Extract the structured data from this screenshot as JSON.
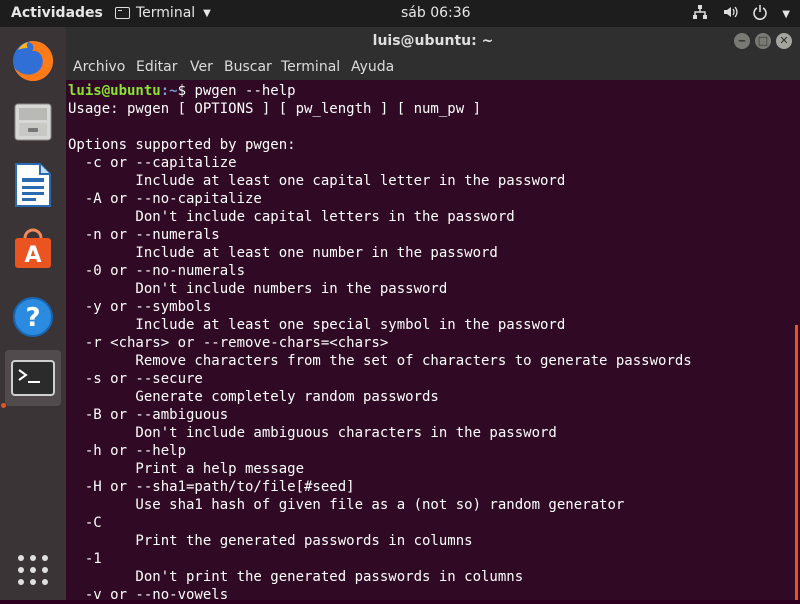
{
  "topbar": {
    "activities": "Actividades",
    "app_name": "Terminal",
    "clock": "sáb 06:36"
  },
  "dock": {
    "items": [
      "firefox-icon",
      "files-icon",
      "writer-icon",
      "software-icon",
      "help-icon",
      "terminal-icon",
      "apps-grid-icon"
    ],
    "active": "terminal-icon"
  },
  "window": {
    "title": "luis@ubuntu: ~",
    "menu": [
      "Archivo",
      "Editar",
      "Ver",
      "Buscar",
      "Terminal",
      "Ayuda"
    ]
  },
  "terminal": {
    "prompt_user": "luis@ubuntu",
    "prompt_path": ":~",
    "prompt_symbol": "$ ",
    "command": "pwgen --help",
    "output": [
      "Usage: pwgen [ OPTIONS ] [ pw_length ] [ num_pw ]",
      "",
      "Options supported by pwgen:",
      "  -c or --capitalize",
      "        Include at least one capital letter in the password",
      "  -A or --no-capitalize",
      "        Don't include capital letters in the password",
      "  -n or --numerals",
      "        Include at least one number in the password",
      "  -0 or --no-numerals",
      "        Don't include numbers in the password",
      "  -y or --symbols",
      "        Include at least one special symbol in the password",
      "  -r <chars> or --remove-chars=<chars>",
      "        Remove characters from the set of characters to generate passwords",
      "  -s or --secure",
      "        Generate completely random passwords",
      "  -B or --ambiguous",
      "        Don't include ambiguous characters in the password",
      "  -h or --help",
      "        Print a help message",
      "  -H or --sha1=path/to/file[#seed]",
      "        Use sha1 hash of given file as a (not so) random generator",
      "  -C",
      "        Print the generated passwords in columns",
      "  -1",
      "        Don't print the generated passwords in columns",
      "  -v or --no-vowels"
    ]
  },
  "colors": {
    "terminal_bg": "#300a24",
    "prompt_user": "#8ae234",
    "prompt_path": "#729fcf",
    "accent": "#e95420"
  }
}
